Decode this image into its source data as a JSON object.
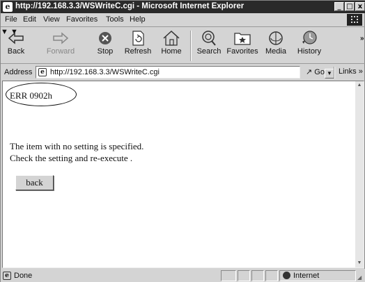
{
  "window": {
    "title": "http://192.168.3.3/WSWriteC.cgi - Microsoft Internet Explorer",
    "logo": "e",
    "minimize": "_",
    "maximize": "□",
    "close": "x"
  },
  "menu": {
    "file": "File",
    "edit": "Edit",
    "view": "View",
    "favorites": "Favorites",
    "tools": "Tools",
    "help": "Help"
  },
  "toolbar": {
    "back": "Back",
    "forward": "Forward",
    "stop": "Stop",
    "refresh": "Refresh",
    "home": "Home",
    "search": "Search",
    "favorites": "Favorites",
    "media": "Media",
    "history": "History",
    "more": "»"
  },
  "address": {
    "label": "Address",
    "url": "http://192.168.3.3/WSWriteC.cgi",
    "go": "Go",
    "links": "Links »"
  },
  "content": {
    "error_code": "ERR 0902h",
    "message_line1": "The item with no setting is specified.",
    "message_line2": "Check the setting and re-execute .",
    "back_button": "back"
  },
  "status": {
    "text": "Done",
    "zone": "Internet"
  },
  "icons": {
    "back": "back-arrow-icon",
    "forward": "forward-arrow-icon",
    "stop": "stop-icon",
    "refresh": "refresh-icon",
    "home": "home-icon",
    "search": "search-icon",
    "favorites": "favorites-icon",
    "media": "media-icon",
    "history": "history-icon",
    "zone": "globe-icon"
  }
}
